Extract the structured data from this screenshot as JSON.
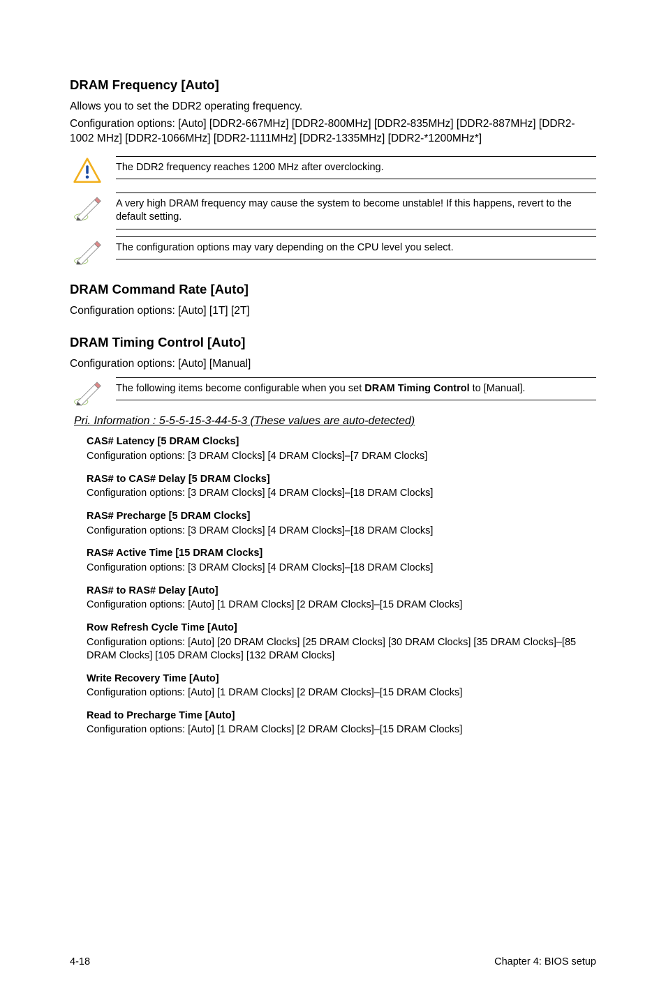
{
  "sections": {
    "dram_frequency": {
      "title": "DRAM Frequency [Auto]",
      "line1": "Allows you to set the DDR2 operating frequency.",
      "line2": "Configuration options: [Auto] [DDR2-667MHz] [DDR2-800MHz] [DDR2-835MHz] [DDR2-887MHz] [DDR2-1002 MHz] [DDR2-1066MHz] [DDR2-1111MHz] [DDR2-1335MHz] [DDR2-*1200MHz*]"
    },
    "dram_command": {
      "title": "DRAM Command Rate [Auto]",
      "config": "Configuration options: [Auto] [1T] [2T]"
    },
    "dram_timing": {
      "title": "DRAM Timing Control [Auto]",
      "config": "Configuration options: [Auto] [Manual]"
    },
    "pri_info": "Pri. Information : 5-5-5-15-3-44-5-3 (These values are auto-detected)"
  },
  "notes": {
    "caution": "The DDR2 frequency reaches 1200 MHz after overclocking.",
    "pencil1": "A very high DRAM frequency may cause the system to become unstable! If this happens, revert to the default setting.",
    "pencil2": "The configuration options may vary depending on the CPU level you select.",
    "pencil3_pre": "The following items become configurable when you set ",
    "pencil3_bold": "DRAM Timing Control",
    "pencil3_post": " to [Manual]."
  },
  "timings": {
    "cas_latency": {
      "label": "CAS# Latency [5 DRAM Clocks]",
      "desc": "Configuration options: [3 DRAM Clocks] [4 DRAM Clocks]–[7 DRAM Clocks]"
    },
    "ras_to_cas": {
      "label": "RAS# to CAS# Delay [5 DRAM Clocks]",
      "desc": "Configuration options: [3 DRAM Clocks] [4 DRAM Clocks]–[18 DRAM Clocks]"
    },
    "ras_precharge": {
      "label": "RAS# Precharge [5 DRAM Clocks]",
      "desc": "Configuration options: [3 DRAM Clocks] [4 DRAM Clocks]–[18 DRAM Clocks]"
    },
    "ras_active": {
      "label": "RAS# Active Time [15 DRAM Clocks]",
      "desc": "Configuration options: [3 DRAM Clocks] [4 DRAM Clocks]–[18 DRAM Clocks]"
    },
    "ras_to_ras": {
      "label": "RAS# to RAS# Delay [Auto]",
      "desc": "Configuration options: [Auto] [1 DRAM Clocks] [2 DRAM Clocks]–[15 DRAM Clocks]"
    },
    "row_refresh": {
      "label": "Row Refresh Cycle Time [Auto]",
      "desc": "Configuration options: [Auto] [20 DRAM Clocks] [25 DRAM Clocks] [30 DRAM Clocks] [35 DRAM Clocks]–[85 DRAM Clocks] [105 DRAM Clocks] [132 DRAM Clocks]"
    },
    "write_recovery": {
      "label": "Write Recovery Time [Auto]",
      "desc": "Configuration options: [Auto] [1 DRAM Clocks] [2 DRAM Clocks]–[15 DRAM Clocks]"
    },
    "read_precharge": {
      "label": "Read to Precharge Time [Auto]",
      "desc": "Configuration options: [Auto] [1 DRAM Clocks] [2 DRAM Clocks]–[15 DRAM Clocks]"
    }
  },
  "footer": {
    "page": "4-18",
    "chapter": "Chapter 4: BIOS setup"
  },
  "icons": {
    "caution": "caution-icon",
    "pencil": "pencil-icon"
  }
}
